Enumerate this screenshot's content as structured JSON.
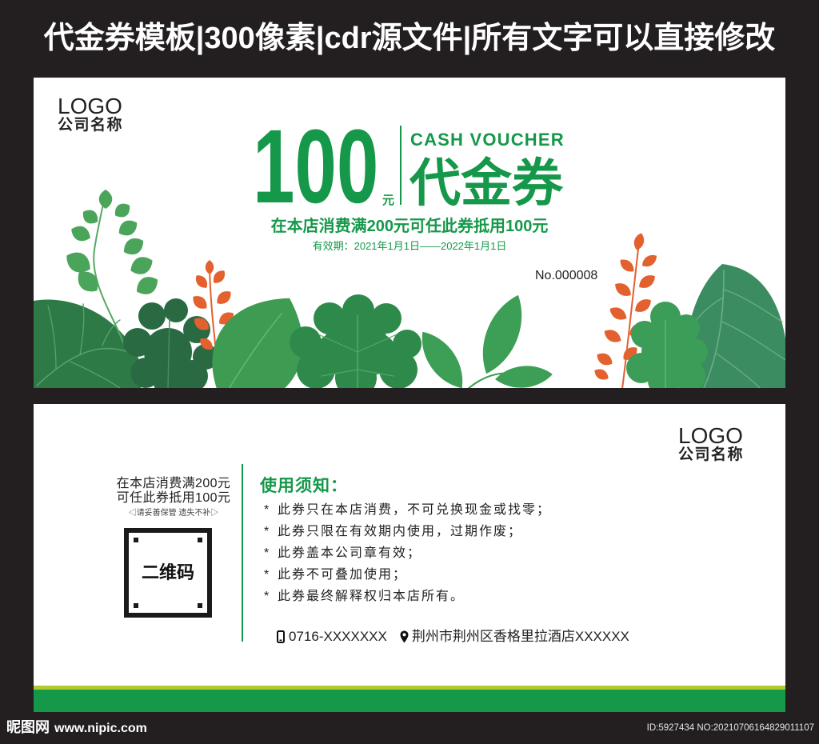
{
  "banner": {
    "title": "代金券模板|300像素|cdr源文件|所有文字可以直接修改"
  },
  "front": {
    "logo": "LOGO",
    "company": "公司名称",
    "amount": "100",
    "unit": "元",
    "cash_voucher": "CASH VOUCHER",
    "voucher": "代金券",
    "offer": "在本店消费满200元可任此券抵用100元",
    "validity": "有效期：2021年1月1日——2022年1月1日",
    "serial": "No.000008"
  },
  "back": {
    "logo": "LOGO",
    "company": "公司名称",
    "offer_line1": "在本店消费满200元",
    "offer_line2": "可任此券抵用100元",
    "keep_note": "◁请妥善保管 遗失不补▷",
    "qr_label": "二维码",
    "notice_title": "使用须知：",
    "bullet": "*",
    "notices": [
      "此券只在本店消费，不可兑换现金或找零；",
      "此券只限在有效期内使用，过期作废；",
      "此券盖本公司章有效；",
      "此券不可叠加使用；",
      "此券最终解释权归本店所有。"
    ],
    "phone": "0716-XXXXXXX",
    "address": "荆州市荆州区香格里拉酒店XXXXXX"
  },
  "watermark": {
    "brand": "昵图网",
    "url": "www.nipic.com",
    "id": "ID:5927434 NO:20210706164829011107"
  },
  "icons": {
    "phone": "phone-icon",
    "location": "location-pin-icon"
  },
  "colors": {
    "background": "#231f20",
    "brand_green": "#15984a",
    "accent_orange": "#e2612f",
    "stripe_yellow": "#b3ca2c"
  }
}
